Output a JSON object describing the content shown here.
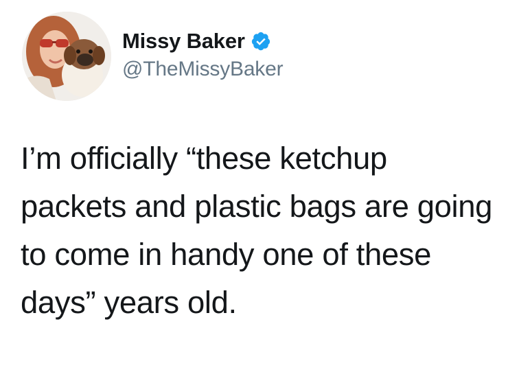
{
  "author": {
    "display_name": "Missy Baker",
    "handle": "@TheMissyBaker",
    "verified": true,
    "verified_badge_color": "#1da1f2"
  },
  "avatar": {
    "description_icon": "profile-photo-woman-with-dog"
  },
  "tweet": {
    "text": "I’m officially “these ketchup packets and plastic bags are going to come in handy one of these days” years old."
  },
  "colors": {
    "name": "#14171a",
    "handle": "#657786",
    "text": "#14171a",
    "background": "#ffffff"
  }
}
